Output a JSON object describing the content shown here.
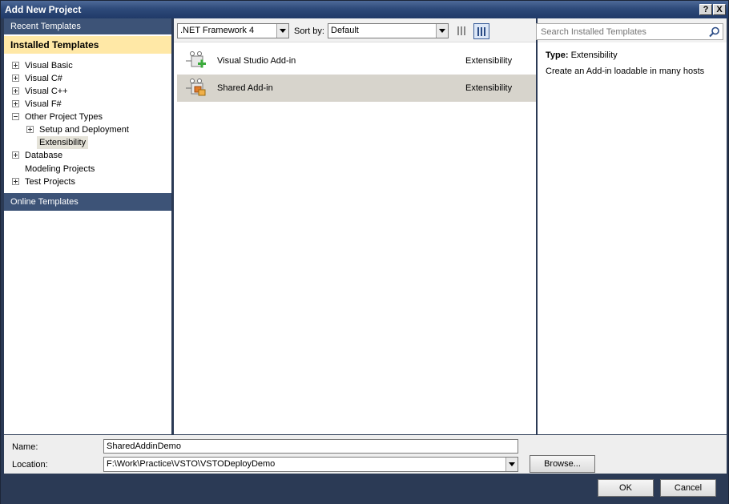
{
  "window": {
    "title": "Add New Project",
    "help_label": "?",
    "close_label": "X"
  },
  "left": {
    "recent_templates": "Recent Templates",
    "installed_templates": "Installed Templates",
    "online_templates": "Online Templates",
    "tree": [
      {
        "label": "Visual Basic",
        "expander": "plus"
      },
      {
        "label": "Visual C#",
        "expander": "plus"
      },
      {
        "label": "Visual C++",
        "expander": "plus"
      },
      {
        "label": "Visual F#",
        "expander": "plus"
      },
      {
        "label": "Other Project Types",
        "expander": "minus"
      },
      {
        "label": "Setup and Deployment",
        "expander": "plus"
      },
      {
        "label": "Extensibility",
        "expander": "none",
        "selected": true
      },
      {
        "label": "Database",
        "expander": "plus"
      },
      {
        "label": "Modeling Projects",
        "expander": "none"
      },
      {
        "label": "Test Projects",
        "expander": "plus"
      }
    ]
  },
  "toolbar": {
    "framework": ".NET Framework 4",
    "sort_by_label": "Sort by:",
    "sort_value": "Default"
  },
  "templates": [
    {
      "name": "Visual Studio Add-in",
      "category": "Extensibility",
      "icon": "addin-icon",
      "selected": false
    },
    {
      "name": "Shared Add-in",
      "category": "Extensibility",
      "icon": "shared-addin-icon",
      "selected": true
    }
  ],
  "search": {
    "placeholder": "Search Installed Templates"
  },
  "details": {
    "type_label": "Type:",
    "type_value": "Extensibility",
    "description": "Create an Add-in loadable in many hosts"
  },
  "form": {
    "name_label": "Name:",
    "name_value": "SharedAddinDemo",
    "location_label": "Location:",
    "location_value": "F:\\Work\\Practice\\VSTO\\VSTODeployDemo",
    "browse_label": "Browse...",
    "ok_label": "OK",
    "cancel_label": "Cancel"
  },
  "colors": {
    "header_blue": "#3d5377",
    "installed_highlight": "#ffe8a6",
    "selected_row": "#d7d4cc"
  }
}
